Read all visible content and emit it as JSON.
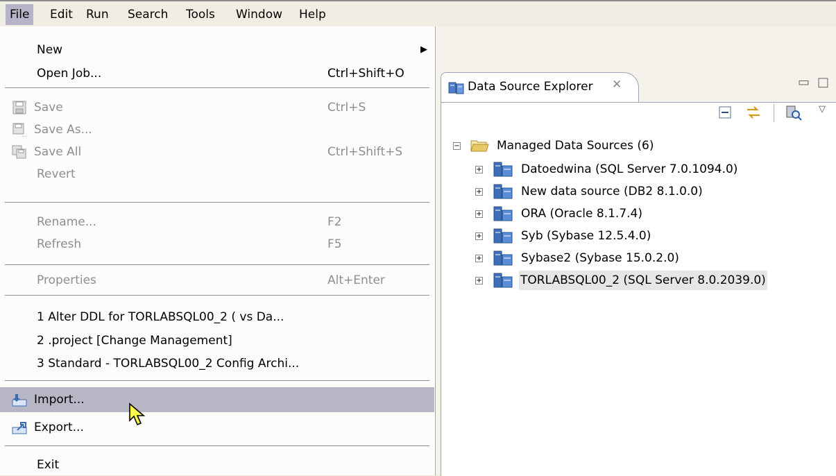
{
  "menubar": {
    "items": [
      {
        "label": "File"
      },
      {
        "label": "Edit"
      },
      {
        "label": "Run"
      },
      {
        "label": "Search"
      },
      {
        "label": "Tools"
      },
      {
        "label": "Window"
      },
      {
        "label": "Help"
      }
    ]
  },
  "file_menu": {
    "new": {
      "label": "New"
    },
    "open_job": {
      "label": "Open Job...",
      "accel": "Ctrl+Shift+O"
    },
    "save": {
      "label": "Save",
      "accel": "Ctrl+S"
    },
    "save_as": {
      "label": "Save As..."
    },
    "save_all": {
      "label": "Save All",
      "accel": "Ctrl+Shift+S"
    },
    "revert": {
      "label": "Revert"
    },
    "rename": {
      "label": "Rename...",
      "accel": "F2"
    },
    "refresh": {
      "label": "Refresh",
      "accel": "F5"
    },
    "properties": {
      "label": "Properties",
      "accel": "Alt+Enter"
    },
    "recent": [
      {
        "label": "1 Alter DDL for TORLABSQL00_2  ( vs Da..."
      },
      {
        "label": "2 .project  [Change Management]"
      },
      {
        "label": "3 Standard - TORLABSQL00_2 Config Archi..."
      }
    ],
    "import": {
      "label": "Import..."
    },
    "export": {
      "label": "Export..."
    },
    "exit": {
      "label": "Exit"
    }
  },
  "explorer": {
    "tab_title": "Data Source Explorer",
    "root": {
      "label": "Managed Data Sources (6)"
    },
    "sources": [
      {
        "label": "Datoedwina (SQL Server 7.0.1094.0)"
      },
      {
        "label": "New data source (DB2 8.1.0.0)"
      },
      {
        "label": "ORA (Oracle 8.1.7.4)"
      },
      {
        "label": "Syb (Sybase 12.5.4.0)"
      },
      {
        "label": "Sybase2 (Sybase 15.0.2.0)"
      },
      {
        "label": "TORLABSQL00_2  (SQL Server 8.0.2039.0)"
      }
    ]
  },
  "colors": {
    "menu_hover": "#b7b6c4",
    "menubar_active": "#b7b3c8",
    "disabled_text": "#8e8e8e"
  }
}
